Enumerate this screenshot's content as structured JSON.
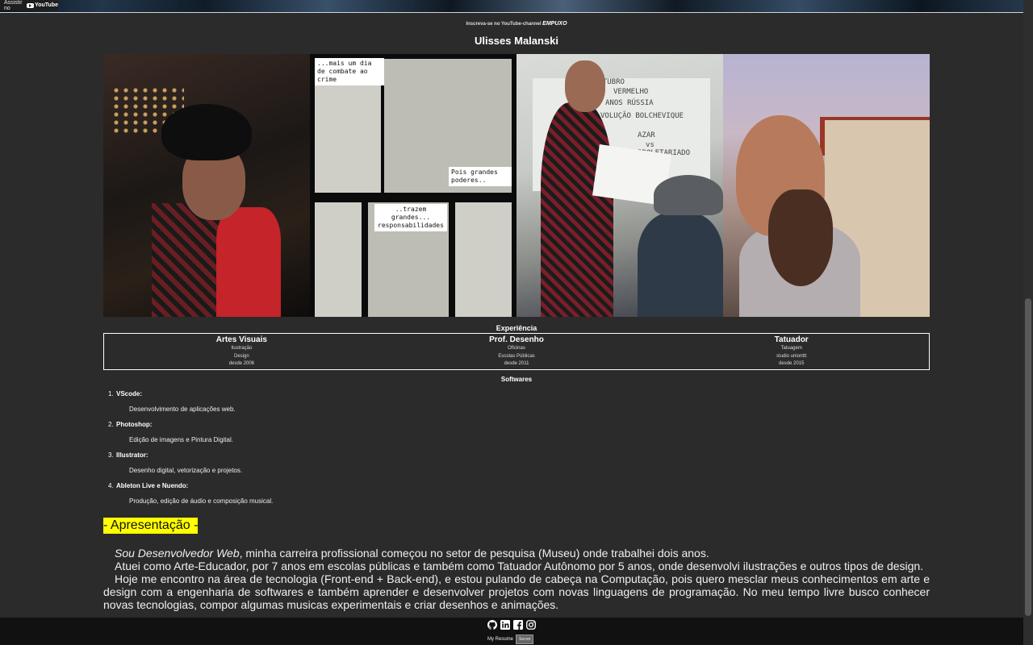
{
  "banner": {
    "watch_label": "Assistir no",
    "youtube_label": "YouTube"
  },
  "header": {
    "subscribe_text": "Inscreva-se no YouTube-channel",
    "channel_name": "EMPUXO",
    "name": "Ulisses Malanski"
  },
  "photos": {
    "comic_caption_1": "...mais um dia de combate ao crime",
    "comic_caption_2": "Pois grandes poderes..",
    "comic_caption_3": "..trazem grandes... responsabilidades",
    "board_text_1": "OUTUBRO",
    "board_text_2": "VERMELHO",
    "board_text_3": "ANOS RÚSSIA",
    "board_text_4": "VOLUÇÃO BOLCHEVIQUE",
    "board_text_5": "AZAR",
    "board_text_6": "vs",
    "board_text_7": "PROLETARIADO"
  },
  "experience": {
    "title": "Experiência",
    "columns": [
      {
        "title": "Artes Visuais",
        "lines": [
          "Ilustração",
          "Design",
          "desde 2006"
        ]
      },
      {
        "title": "Prof. Desenho",
        "lines": [
          "Oficinas",
          "Escolas Públicas",
          "desde 2011"
        ]
      },
      {
        "title": "Tatuador",
        "lines": [
          "Tatuagem",
          "studio unionttt",
          "desde 2015"
        ]
      }
    ]
  },
  "softwares": {
    "title": "Softwares",
    "items": [
      {
        "num": "1.",
        "name": "VScode:",
        "desc": "Desenvolvimento de aplicações web."
      },
      {
        "num": "2.",
        "name": "Photoshop:",
        "desc": "Edição de imagens e Pintura Digital."
      },
      {
        "num": "3.",
        "name": "Illustrator:",
        "desc": "Desenho digital, vetorização e projetos."
      },
      {
        "num": "4.",
        "name": "Ableton Live e Nuendo:",
        "desc": "Produção, edição de áudio e composição musical."
      }
    ]
  },
  "presentation": {
    "title": "- Apresentação -",
    "p1_em": "Sou Desenvolvedor Web",
    "p1_rest": ", minha carreira profissional começou no setor de pesquisa (Museu) onde trabalhei dois anos.",
    "p2": "Atuei como Arte-Educador, por 7 anos em escolas públicas e também como Tatuador Autônomo por 5 anos, onde desenvolvi ilustrações e outros tipos de design.",
    "p3": "Hoje me encontro na área de tecnologia (Front-end + Back-end), e estou pulando de cabeça na Computação, pois quero mesclar meus conhecimentos em arte e design com a engenharia de softwares e também aprender e desenvolver projetos com novas linguagens de programação. No meu tempo livre busco conhecer novas tecnologias, compor algumas musicas experimentais e criar desenhos e animações."
  },
  "footer": {
    "icons": [
      "github-icon",
      "linkedin-icon",
      "facebook-icon",
      "instagram-icon"
    ],
    "resume_label": "My Resume",
    "secret_label": "Secret"
  },
  "colors": {
    "background": "#2b2b2b",
    "highlight": "#ffff00",
    "footer": "#111111"
  }
}
